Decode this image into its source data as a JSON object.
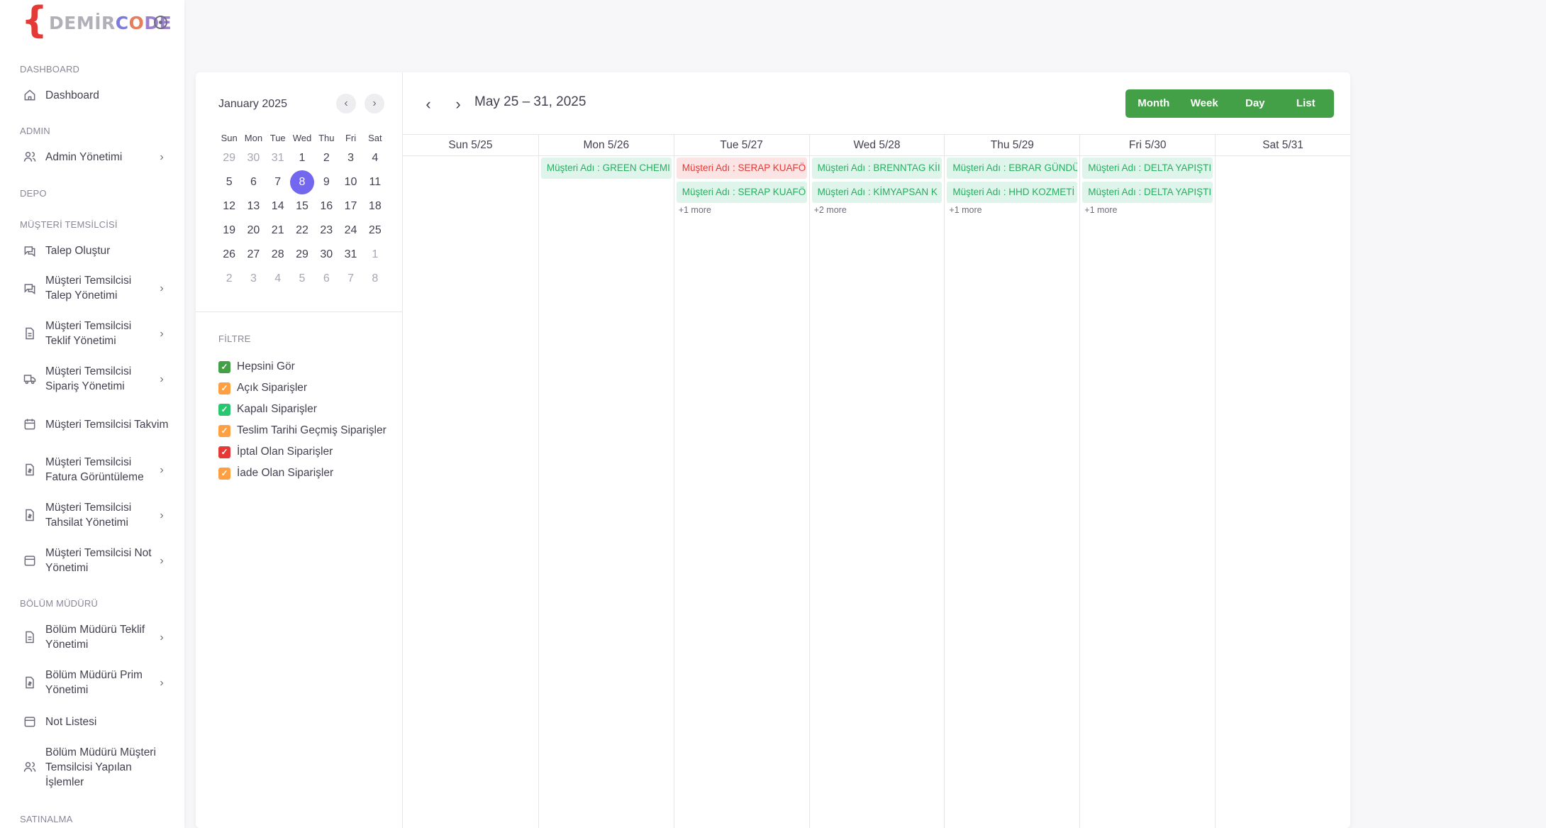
{
  "brand": {
    "brace": "{",
    "part1": "DEMİR",
    "part2": "C",
    "part3": "O",
    "part4": "DE"
  },
  "sidebar": {
    "sections": {
      "dashboard": "DASHBOARD",
      "admin": "ADMIN",
      "depo": "DEPO",
      "musteri": "MÜŞTERİ TEMSİLCİSİ",
      "bolum": "BÖLÜM MÜDÜRÜ",
      "satinalma": "SATINALMA"
    },
    "items": [
      {
        "label": "Dashboard",
        "icon": "home-icon"
      },
      {
        "label": "Admin Yönetimi",
        "icon": "users-icon"
      },
      {
        "label": "Talep Oluştur",
        "icon": "message-icon"
      },
      {
        "label": "Müşteri Temsilcisi Talep Yönetimi",
        "icon": "messages-icon"
      },
      {
        "label": "Müşteri Temsilcisi Teklif Yönetimi",
        "icon": "file-icon"
      },
      {
        "label": "Müşteri Temsilcisi Sipariş Yönetimi",
        "icon": "truck-icon"
      },
      {
        "label": "Müşteri Temsilcisi Takvim",
        "icon": "calendar-icon"
      },
      {
        "label": "Müşteri Temsilcisi Fatura Görüntüleme",
        "icon": "invoice-icon"
      },
      {
        "label": "Müşteri Temsilcisi Tahsilat Yönetimi",
        "icon": "invoice-icon"
      },
      {
        "label": "Müşteri Temsilcisi Not Yönetimi",
        "icon": "note-icon"
      },
      {
        "label": "Bölüm Müdürü Teklif Yönetimi",
        "icon": "file-icon"
      },
      {
        "label": "Bölüm Müdürü Prim Yönetimi",
        "icon": "invoice-icon"
      },
      {
        "label": "Not Listesi",
        "icon": "note-icon"
      },
      {
        "label": "Bölüm Müdürü Müşteri Temsilcisi Yapılan İşlemler",
        "icon": "users-icon"
      }
    ]
  },
  "mini_calendar": {
    "title": "January 2025",
    "weekdays": [
      "Sun",
      "Mon",
      "Tue",
      "Wed",
      "Thu",
      "Fri",
      "Sat"
    ],
    "weeks": [
      [
        "29",
        "30",
        "31",
        "1",
        "2",
        "3",
        "4"
      ],
      [
        "5",
        "6",
        "7",
        "8",
        "9",
        "10",
        "11"
      ],
      [
        "12",
        "13",
        "14",
        "15",
        "16",
        "17",
        "18"
      ],
      [
        "19",
        "20",
        "21",
        "22",
        "23",
        "24",
        "25"
      ],
      [
        "26",
        "27",
        "28",
        "29",
        "30",
        "31",
        "1"
      ],
      [
        "2",
        "3",
        "4",
        "5",
        "6",
        "7",
        "8"
      ]
    ],
    "selected": "8"
  },
  "filters": {
    "title": "FİLTRE",
    "items": [
      {
        "label": "Hepsini Gör",
        "color": "#43a047",
        "checked": true
      },
      {
        "label": "Açık Siparişler",
        "color": "#ff9f43",
        "checked": true
      },
      {
        "label": "Kapalı Siparişler",
        "color": "#28c76f",
        "checked": true
      },
      {
        "label": "Teslim Tarihi Geçmiş Siparişler",
        "color": "#ff9f43",
        "checked": true
      },
      {
        "label": "İptal Olan Siparişler",
        "color": "#e53935",
        "checked": true
      },
      {
        "label": "İade Olan Siparişler",
        "color": "#ff9f43",
        "checked": true
      }
    ]
  },
  "calendar": {
    "range_title": "May 25 – 31, 2025",
    "views": [
      "Month",
      "Week",
      "Day",
      "List"
    ],
    "days": [
      {
        "label": "Sun 5/25",
        "events": [],
        "more": ""
      },
      {
        "label": "Mon 5/26",
        "events": [
          {
            "text": "Müşteri Adı : GREEN CHEMI",
            "color": "green"
          }
        ],
        "more": ""
      },
      {
        "label": "Tue 5/27",
        "events": [
          {
            "text": "Müşteri Adı : SERAP KUAFÖ",
            "color": "red"
          },
          {
            "text": "Müşteri Adı : SERAP KUAFÖ",
            "color": "green"
          }
        ],
        "more": "+1 more"
      },
      {
        "label": "Wed 5/28",
        "events": [
          {
            "text": "Müşteri Adı : BRENNTAG KİI",
            "color": "green"
          },
          {
            "text": "Müşteri Adı : KİMYAPSAN K",
            "color": "green"
          }
        ],
        "more": "+2 more"
      },
      {
        "label": "Thu 5/29",
        "events": [
          {
            "text": "Müşteri Adı : EBRAR GÜNDÜ",
            "color": "green"
          },
          {
            "text": "Müşteri Adı : HHD KOZMETİ",
            "color": "green"
          }
        ],
        "more": "+1 more"
      },
      {
        "label": "Fri 5/30",
        "events": [
          {
            "text": "Müşteri Adı : DELTA YAPIŞTI",
            "color": "green"
          },
          {
            "text": "Müşteri Adı : DELTA YAPIŞTI",
            "color": "green"
          }
        ],
        "more": "+1 more"
      },
      {
        "label": "Sat 5/31",
        "events": [],
        "more": ""
      }
    ]
  }
}
